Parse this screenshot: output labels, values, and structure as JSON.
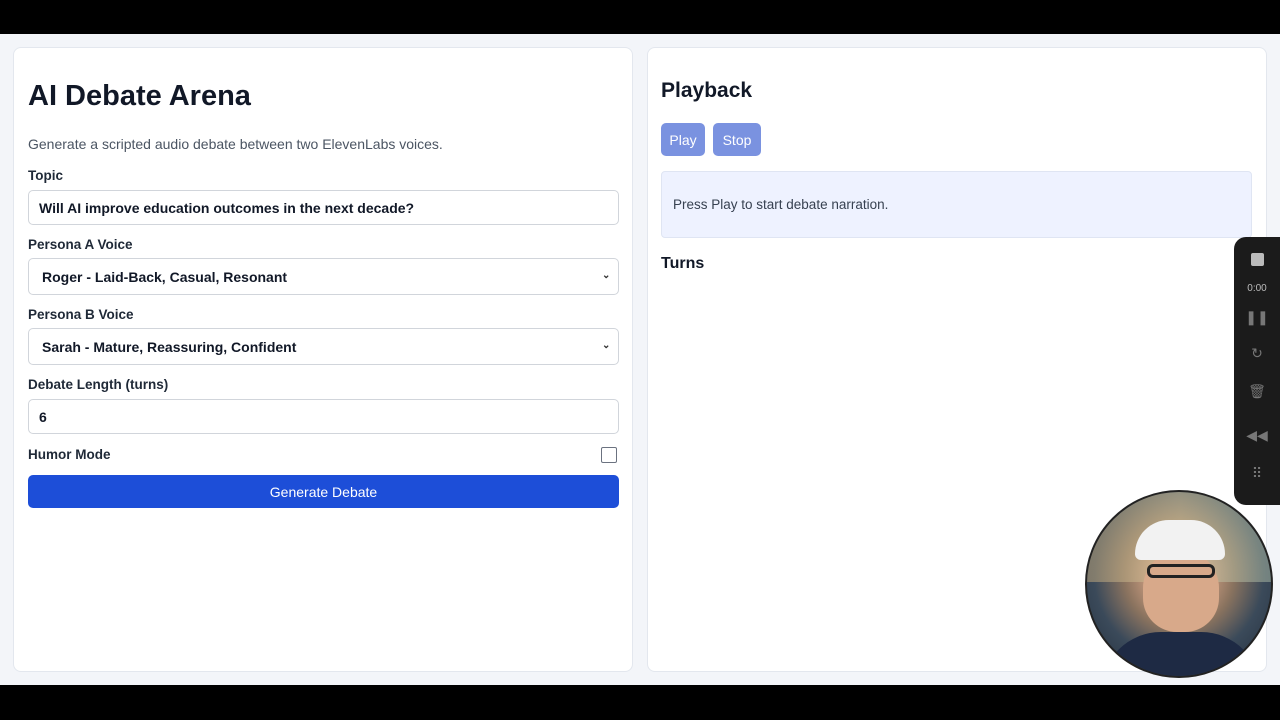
{
  "left": {
    "title": "AI Debate Arena",
    "subtitle": "Generate a scripted audio debate between two ElevenLabs voices.",
    "topic_label": "Topic",
    "topic_value": "Will AI improve education outcomes in the next decade?",
    "persona_a_label": "Persona A Voice",
    "persona_a_value": "Roger - Laid-Back, Casual, Resonant",
    "persona_b_label": "Persona B Voice",
    "persona_b_value": "Sarah - Mature, Reassuring, Confident",
    "length_label": "Debate Length (turns)",
    "length_value": "6",
    "humor_label": "Humor Mode",
    "humor_checked": false,
    "generate_label": "Generate Debate"
  },
  "right": {
    "title": "Playback",
    "play_label": "Play",
    "stop_label": "Stop",
    "status_text": "Press Play to start debate narration.",
    "turns_label": "Turns"
  },
  "recorder": {
    "time": "0:00"
  },
  "colors": {
    "primary": "#1d4ed8",
    "playback_button": "#7a92e0",
    "status_bg": "#eef2ff"
  }
}
